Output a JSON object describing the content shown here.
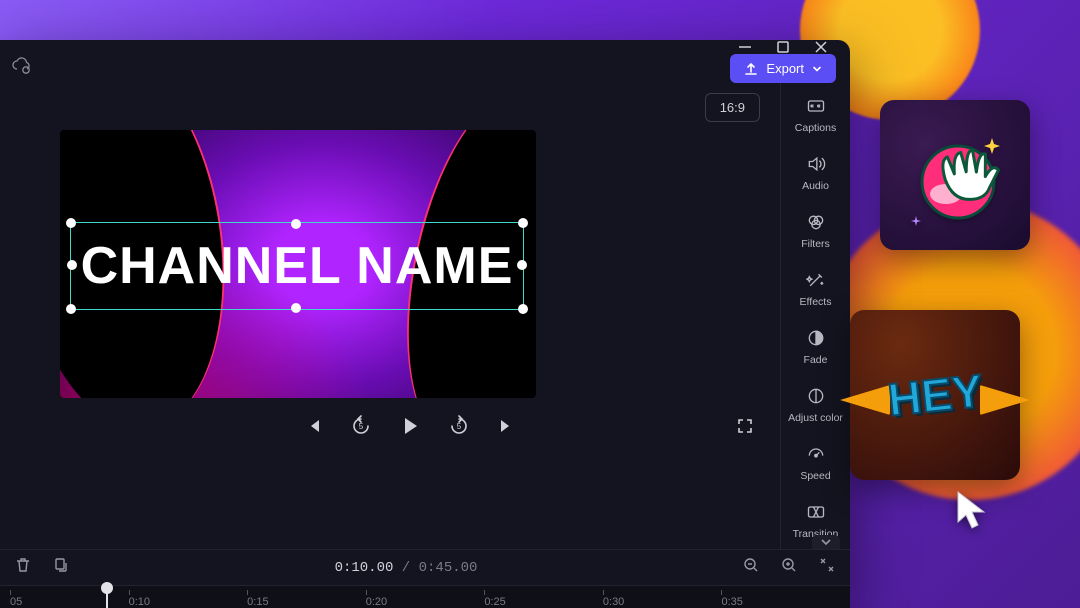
{
  "window": {
    "minimize": "–",
    "maximize": "▢",
    "close": "✕"
  },
  "toolbar": {
    "export_label": "Export",
    "ratio_label": "16:9"
  },
  "canvas": {
    "selected_text": "CHANNEL NAME"
  },
  "timecode": {
    "current": "0:10.00",
    "separator": " / ",
    "duration": "0:45.00"
  },
  "ruler": {
    "ticks": [
      "05",
      "0:10",
      "0:15",
      "0:20",
      "0:25",
      "0:30",
      "0:35"
    ]
  },
  "side_panel": [
    {
      "id": "captions",
      "label": "Captions"
    },
    {
      "id": "audio",
      "label": "Audio"
    },
    {
      "id": "filters",
      "label": "Filters"
    },
    {
      "id": "effects",
      "label": "Effects"
    },
    {
      "id": "fade",
      "label": "Fade"
    },
    {
      "id": "adjust",
      "label": "Adjust color"
    },
    {
      "id": "speed",
      "label": "Speed"
    },
    {
      "id": "transition",
      "label": "Transition"
    }
  ],
  "sticker2_text": "HEY",
  "colors": {
    "accent": "#5b4ef5",
    "selection": "#3ed9c9"
  }
}
